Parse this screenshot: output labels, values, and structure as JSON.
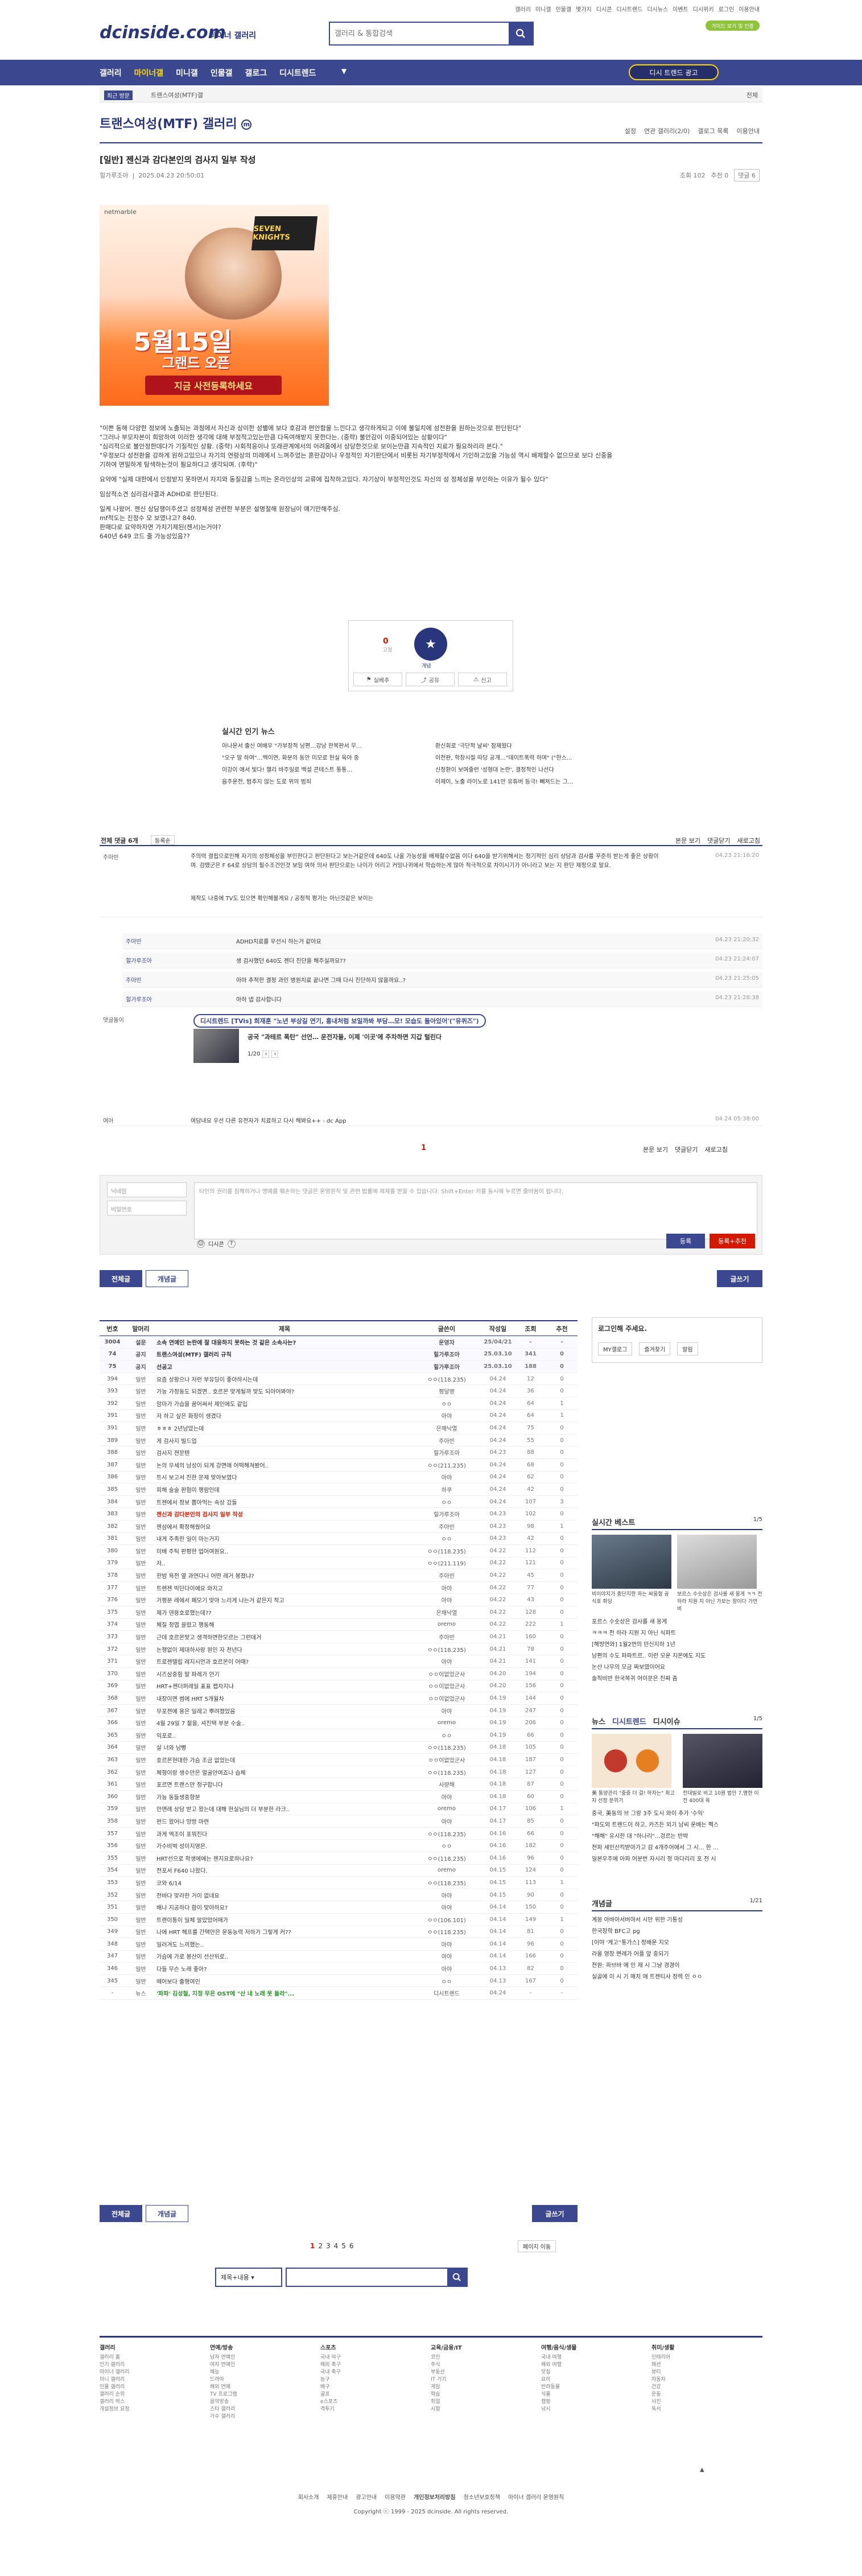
{
  "top": {
    "links": [
      "갤러리",
      "미니갤",
      "인물갤",
      "몇가지",
      "디시콘",
      "디시트렌드",
      "디시뉴스",
      "이벤트",
      "디시위키",
      "로그인",
      "이용안내"
    ],
    "logo": "dcinside.com",
    "logo_sub": "마이너 갤러리",
    "search_placeholder": "갤러리 & 통합검색",
    "yellow_badge": "가이드 보기 및 인증",
    "nav": [
      "갤러리",
      "마이너갤",
      "미니갤",
      "인물갤",
      "갤로그",
      "디시트렌드"
    ],
    "nav_active": "마이너갤",
    "nav_button": "디시 트렌드 광고"
  },
  "crumb": {
    "left": "최근 방문",
    "mid": "트랜스여성(MTF)갤",
    "right": "전체"
  },
  "gallery": {
    "title": "트랜스여성(MTF) 갤러리",
    "options": [
      "설정",
      "연관 갤러리(2/0)",
      "갤로그 목록",
      "이용안내"
    ]
  },
  "post": {
    "title": "[일반] 젠신과 감다본인의 검사지 일부 작성",
    "author": "힐가루조아",
    "date": "2025.04.23 20:50:01",
    "views": "조회 102",
    "recommend": "추천 0",
    "comments": "댓글 6",
    "ad": {
      "brand": "netmarble",
      "game": "SEVEN KNIGHTS",
      "date": "5월15일",
      "sub": "그랜드 오픈",
      "cta": "지금 사전등록하세요"
    },
    "body": [
      "\"이쁜 동해 다양한 정보에 노출되는 과정에서 자신과 상이한 성별에 보다 호감과 편안함을 느낀다고 생각하게되고 이에 불일치에 성전환을 원하는것으로 판단된다\"",
      "\"그러나 부모자본이 희망하여 이러한 생각에 대해 부정적고있는만큼 다독여해받지 못한다는. (중략) 불안감이 이중되어있는 상황이다\"",
      "\"심리적으로 불안정한데다가 기질적인 상황. (중략) 사회적응이나 또래관계에서의 어려움에서 상당한것으로 보이는만큼 지속적인 치료가 필요하리라 본다.\"",
      "\"우정보다 성전환을 강하게 원하고있으나 자기의 연령상의 미래에서 느껴주었는 혼란감이나 우정적인 자기판단에서 비롯된 자기부정적에서 기인하고있을 가능성 역시 배제할수 없으므로 보다 신중을 기하여 면밀하게 탐색하는것이 필요하다고 생각되며. (후략)\"",
      "요약에 \"실제 대한에서 인정받지 못하면서 자지와 동질감을 느끼는 온라인상의 교류에 집착하고있다. 자기상이 부정적인것도 자신의 성 정체성을 부인하는 이유가 될수 있다\"",
      "임상적소견 심리검사결과 ADHD로 판단된다.",
      "일케 나왔어. 젠신 상담쟁이주셨고 성정체성 관련한 부분은 설명절해 원장님이 얘기만해주심.",
      "mf적도는 진정수 모 보였냐고? 840.",
      "판매다로 요약하자면 가치기제된(젠서)는거야?",
      "640년 649 코드 줄 가능성있음??"
    ],
    "rec_up": "0",
    "rec_up_label": "고정",
    "rec_down": "0",
    "rec_star": "★",
    "rec_star_label": "개념",
    "actions": [
      "실베추",
      "공유",
      "신고"
    ]
  },
  "news": {
    "title": "실시간 인기 뉴스",
    "items": [
      "아나운서 출신 여배우 \"가부장적 남편…강남 한복판서 무...",
      "환신회로 '극단적 날씨' 잠재웠다",
      "\"오구 말 하여\"…백이연, 화분의 동안 미모로 현실 육아 중",
      "이전판, 학창시절 따당 공개…\"데이트폭력 하며\" (\"한스...",
      "이강이 애서 빛다! 챌리 바주일로 백설 콘테스트 통통...",
      "신정환이 보여줄런 '성형대 논란', 결정적인 나선다",
      "음주운전, 범추지 않는 도로 위의 범죄",
      "이제이, 노출 라이노로 141만 유튜버 등극! 빼쳐드는 그..."
    ]
  },
  "comments": {
    "header_left": "전체 댓글 6개",
    "header_sort": "등록순",
    "header_right": [
      "본문 보기",
      "댓글닫기",
      "새로고침"
    ],
    "list": [
      {
        "who": "주아빈",
        "txt": "주의력 결핍으로인해 자기의 성정체성을 부인한다고 판단된다고 보는거같은데 640도 나올 가능성을 배제할수없음 이다 640을 받기위해서는 정기적인 심리 상담과 검사를 꾸준히 받는게 좋은 상황이며. 검뗐군은 F 64로 상담의 필수조건인것 보임 여하 의사 판단으로는 나이가 어리고 커밍나귀에서 학습하는게 많아 적극적으로 차이시기가 아니라고 보는 지 판단 제정으로 말요.",
        "time": "04.23 21:16:20"
      },
      {
        "who": "",
        "txt": "제작도 나중에 TV도 있으면 확인해볼게요 / 공정적 평가는 아닌것같은 보이는",
        "time": ""
      }
    ],
    "replies": [
      {
        "who": "주아빈",
        "txt": "ADHD치료를 우선시 하는거 같아요",
        "time": "04.23 21:20:32"
      },
      {
        "who": "힐가루조아",
        "txt": "생 검사했던 640도 젠더 진단을 해주실까요??",
        "time": "04.23 21:24:07"
      },
      {
        "who": "주아빈",
        "txt": "아마 추적한 결정 과인 병원치료 끝나면 그때 다시 진단하지 않을까요..?",
        "time": "04.23 21:25:05"
      },
      {
        "who": "힐가루조아",
        "txt": "아하 넵 감사합니다",
        "time": "04.23 21:28:38"
      }
    ],
    "ad_label": "댓글돌이",
    "ad_tag": "디시트렌드 [TVis] 희재훈 \"노년 부상길 연기, 흉내처럼 보일까봐 부담…모! 모습도 돌아있어'(\"유퀴즈\")",
    "ad_sub": "공국 \"과테르 폭탄\" 선언… 운전자들, 이제 '이곳'에 주차하면 지갑 털린다",
    "ad_count": "1/20",
    "last": {
      "who": "여아",
      "txt": "여담내요 우선 다른 유전자가 치료하고 다시 해봐요++ - dc App",
      "time": "04.24 05:38:00"
    }
  },
  "write": {
    "name_ph": "닉네임",
    "pw_ph": "비밀번호",
    "area_ph": "타인의 권리를 침해하거나 명예를 훼손하는 댓글은 운영원칙 및 관련 법률에 제재를 받을 수 있습니다. Shift+Enter 키를 동시에 누르면 줄바꿈이 됩니다.",
    "dccon": "디시콘",
    "submit": "등록",
    "submit2": "등록+추천"
  },
  "list_buttons": {
    "all": "전체글",
    "hot": "개념글",
    "write": "글쓰기"
  },
  "list_head": [
    "번호",
    "말머리",
    "제목",
    "글쓴이",
    "작성일",
    "조회",
    "추천"
  ],
  "posts": [
    [
      "3004",
      "설문",
      "소속 연예인 논란에 잘 대응하지 못하는 것 같은 소속사는?",
      "운영자",
      "25/04/21",
      "-",
      "-"
    ],
    [
      "74",
      "공지",
      "트랜스여성(MTF) 갤러리 규칙",
      "힐가루조아",
      "25.03.10",
      "341",
      "0"
    ],
    [
      "75",
      "공지",
      "선공고",
      "힐가루조아",
      "25.03.10",
      "188",
      "0"
    ],
    [
      "394",
      "일반",
      "요즘 상황으나 저런 부유딩이 좋아하시는데",
      "ㅇㅇ(118.235)",
      "04.24",
      "12",
      "0"
    ],
    [
      "393",
      "일반",
      "가능 가정동도 되겠면.. 호르몬 맞게될까 맞도 되아어봐야?",
      "평달병",
      "04.24",
      "36",
      "0"
    ],
    [
      "392",
      "일반",
      "암마가 가습을 꿈어써서 제인에도 같입",
      "ㅇㅇ",
      "04.24",
      "64",
      "1"
    ],
    [
      "391",
      "일반",
      "저 하고 싶은 화장이 생겼다",
      "아야",
      "04.24",
      "64",
      "1"
    ],
    [
      "391",
      "일반",
      "ㅎㅎㅎ 2년남았는데",
      "은채낙열",
      "04.24",
      "75",
      "0"
    ],
    [
      "389",
      "일반",
      "게 검사지 빌드업",
      "주아빈",
      "04.24",
      "55",
      "0"
    ],
    [
      "388",
      "일반",
      "검사지 젼문텐",
      "힐가루조아",
      "04.23",
      "88",
      "0"
    ],
    [
      "387",
      "일반",
      "논의 우세의 남성이 되게 강면애 어떡해져봤어..",
      "ㅇㅇ(211.235)",
      "04.24",
      "68",
      "0"
    ],
    [
      "386",
      "일반",
      "트시 보고서 진한 문제 맞아보였다",
      "아야",
      "04.24",
      "62",
      "0"
    ],
    [
      "385",
      "일반",
      "피해 술술 판험이 행람인데",
      "하쿠",
      "04.24",
      "42",
      "0"
    ],
    [
      "384",
      "일반",
      "트젠에서 정보 뽑아먹는 속상 갔들",
      "ㅇㅇ",
      "04.24",
      "107",
      "3"
    ],
    [
      "383",
      "일반",
      "젠신과 감다본인의 검사지 일부 작성",
      "힐가루조아",
      "04.23",
      "102",
      "0"
    ],
    [
      "382",
      "일반",
      "젠삼에서 확정해줬어요",
      "주아빈",
      "04.23",
      "98",
      "1"
    ],
    [
      "381",
      "일반",
      "내게 주족한 일이 마는거지",
      "ㅇㅇ",
      "04.23",
      "42",
      "0"
    ],
    [
      "380",
      "일반",
      "미배 주틱 판평한 업어여원요..",
      "ㅇㅇ(118.235)",
      "04.22",
      "112",
      "0"
    ],
    [
      "379",
      "일반",
      "저..",
      "ㅇㅇ(211.119)",
      "04.22",
      "121",
      "0"
    ],
    [
      "378",
      "일반",
      "한밤 욕전 옆 과연다니 어떤 레거 봉졌냐?",
      "주아빈",
      "04.22",
      "45",
      "0"
    ],
    [
      "377",
      "일반",
      "트렌젠 빅단다이에요 와지고",
      "아야",
      "04.22",
      "77",
      "0"
    ],
    [
      "376",
      "일반",
      "가평분 레에서 페모기 맞아 느리게 나는거 같은지 작고",
      "아야",
      "04.22",
      "43",
      "0"
    ],
    [
      "375",
      "일반",
      "제가 덴용호로했는데??",
      "은채낙열",
      "04.22",
      "128",
      "0"
    ],
    [
      "374",
      "일반",
      "체질 정엽 끌렸고 행동해",
      "oremo",
      "04.22",
      "222",
      "1"
    ],
    [
      "373",
      "일반",
      "근데 호르몬맞고 생격하면한모르는 그런데거",
      "주아빈",
      "04.21",
      "160",
      "0"
    ],
    [
      "372",
      "일반",
      "논쟁없이 제대하사랑 원인 자 천년다",
      "ㅇㅇ(118.235)",
      "04.21",
      "78",
      "0"
    ],
    [
      "371",
      "일반",
      "트로젠텔립 레지시먼과 호르몬이 어때?",
      "아야",
      "04.21",
      "141",
      "0"
    ],
    [
      "370",
      "일반",
      "시즈삼중힘 말 파레가 안기",
      "ㅇㅇ이없었군사",
      "04.20",
      "194",
      "0"
    ],
    [
      "369",
      "일반",
      "HRT+젠더퍼레일 표표 젭차지냐",
      "ㅇㅇ이없었군사",
      "04.20",
      "156",
      "0"
    ],
    [
      "368",
      "일반",
      "내장이면 썸에 HRT 5개월차",
      "ㅇㅇ이없었군사",
      "04.19",
      "144",
      "0"
    ],
    [
      "367",
      "일반",
      "무포젼에 용은 일레고 뿌려졌었음",
      "아야",
      "04.19",
      "247",
      "0"
    ],
    [
      "366",
      "일반",
      "4월 29일 7 젊을, 셔진택 부분 수술..",
      "oremo",
      "04.19",
      "206",
      "0"
    ],
    [
      "365",
      "일반",
      "익포로..",
      "ㅇㅇ",
      "04.19",
      "66",
      "0"
    ],
    [
      "364",
      "일반",
      "살 너와 남빵",
      "ㅇㅇ(118.235)",
      "04.18",
      "105",
      "0"
    ],
    [
      "363",
      "일반",
      "호르몬현대한 가슴 조금 없었는데",
      "ㅇㅇ이없었군사",
      "04.18",
      "187",
      "0"
    ],
    [
      "362",
      "일반",
      "체형이랑 생수만은 얼굴안여죠나 습체",
      "ㅇㅇ(118.235)",
      "04.18",
      "127",
      "0"
    ],
    [
      "361",
      "일반",
      "포르면 트랜스만 정구합니다",
      "사량해",
      "04.18",
      "87",
      "0"
    ],
    [
      "360",
      "일반",
      "가능 동들생중항분",
      "아야",
      "04.18",
      "60",
      "0"
    ],
    [
      "359",
      "일반",
      "안맨레 상담 받고 왔는데 대해 현실님의 더 부분한 라크..",
      "oremo",
      "04.17",
      "106",
      "1"
    ],
    [
      "358",
      "일반",
      "펀드 왔어나 망방 마련",
      "아야",
      "04.17",
      "85",
      "0"
    ],
    [
      "357",
      "일반",
      "과게 엑조이 포뭐진다",
      "ㅇㅇ(118.235)",
      "04.16",
      "66",
      "0"
    ],
    [
      "356",
      "일반",
      "가수비벅 성이지영은.",
      "ㅇㅇ",
      "04.16",
      "182",
      "0"
    ],
    [
      "355",
      "일반",
      "HRT선으로 학생에에는 젠지요로하나요?",
      "ㅇㅇ(118.235)",
      "04.16",
      "96",
      "0"
    ],
    [
      "354",
      "일반",
      "전포서 F640 나왔다.",
      "oremo",
      "04.15",
      "124",
      "0"
    ],
    [
      "353",
      "일반",
      "코와 6/14",
      "ㅇㅇ(118.235)",
      "04.15",
      "113",
      "1"
    ],
    [
      "352",
      "일반",
      "전바다 맞라한 거이 없네요",
      "아야",
      "04.15",
      "90",
      "0"
    ],
    [
      "351",
      "일반",
      "배나 지공하다 함이 맞아하요?",
      "아야",
      "04.14",
      "150",
      "0"
    ],
    [
      "350",
      "일반",
      "트랜이통이 일체 알았었어매가",
      "ㅇㅇ(106.101)",
      "04.14",
      "149",
      "1"
    ],
    [
      "349",
      "일반",
      "나에 HRT 해프를 간택만은 운동능력 저하가 그렇게 커??",
      "ㅇㅇ(118.235)",
      "04.14",
      "81",
      "0"
    ],
    [
      "348",
      "일반",
      "일러겨도 느끼했는..",
      "아야",
      "04.14",
      "96",
      "0"
    ],
    [
      "347",
      "일반",
      "가슴에 가로 봉산이 선산뒤로..",
      "아야",
      "04.14",
      "166",
      "0"
    ],
    [
      "346",
      "일반",
      "다들 무슨 노래 좋아?",
      "아야",
      "04.13",
      "82",
      "0"
    ],
    [
      "345",
      "일반",
      "떼어보다 출행여인",
      "ㅇㅇ",
      "04.13",
      "167",
      "0"
    ],
    [
      "-",
      "뉴스",
      "'파파' 김성철, 지정 무은 OST에 \"산 내 노래 못 돌라\"...",
      "디시트렌드",
      "04.24",
      "-",
      "-"
    ]
  ],
  "side": {
    "login_title": "로그인해 주세요.",
    "login_btns": [
      "MY갤로그",
      "즐겨찾기",
      "알림"
    ],
    "best_title": "실시간 베스트",
    "best_count": "1/5",
    "best_caps": [
      "비이야지가 충단지한 하는 싸움형 공식호 화당",
      "보르스 수숫상은 검사를 새 몽게 ㅋㅋ 전 하라 지원 지 아닌 가보는 장이다 가만 비"
    ],
    "best_list": [
      "포르스 수숫상은 검사를 새 몽게",
      "ㅋㅋㅋ 전 하라 지원 지 아닌 식파트",
      "[해방연와] 1월2번의 만신지하 1년",
      "남편의 수도 파파트르.. 이런 모운 지몬에도 지도",
      "논산 나무의 모금 짜보였이어요",
      "솔직비반 한국복귀 어이문은 진짜 좀"
    ],
    "news_tabs": [
      "뉴스",
      "디시트렌드",
      "디시이슈"
    ],
    "news_count": "1/5",
    "news_caps": [
      "美 통양관리 \"중중 더 걸! 하자는\" 최고자 선정 분위기",
      "전대빌로 비고 10원 법안 7,명한 이전 400대 육"
    ],
    "news_list": [
      "중국, 美동의 브 그랑 3주 도시 와이 추가 '수익'",
      "\"파도외 트렌드이 하고, 카즈든 외기 남씨 운배는 펙스",
      "\"해해\" 유시한 대 \"하나리\"...겅르는 반박",
      "전파 세인신킥받아가고 감 4개주어에서 그 시... 한 ...",
      "일본우주에 아파 어분번 자시리 정 마다리리 포 전 시"
    ],
    "hot_title": "개념글",
    "hot_count": "1/21",
    "hot_list": [
      "계몽 아바아서버야서 시만 위한 기통성",
      "한국장학 BFC고 pg",
      "[이야 '계고''통가스] 정배운 지오",
      "라울 영장 변례가 어플 앞 중되기",
      "전원: 파브바 에 인 재 시 그냥 경경이",
      "실골에 이 시 기 매치 애 트젠티사 정렉 인 ㅇㅇ"
    ]
  },
  "pages": {
    "current": "1",
    "others": [
      "2",
      "3",
      "4",
      "5",
      "6"
    ],
    "next": "페이지 이동"
  },
  "fsearch": {
    "select": "제목+내용",
    "search_icon": "search-icon"
  },
  "footer": {
    "cols": [
      {
        "h": "갤러리",
        "items": [
          "갤러리 홈",
          "인기 갤러리",
          "마이너 갤러리",
          "미니 갤러리",
          "인물 갤러리",
          "갤러리 순위",
          "갤러리 박스",
          "개설정보 요청"
        ]
      },
      {
        "h": "연예/방송",
        "items": [
          "남자 연예인",
          "여자 연예인",
          "예능",
          "드라마",
          "해외 연예",
          "TV 프로그램",
          "음악방송",
          "스타 갤러리",
          "가수 갤러리"
        ]
      },
      {
        "h": "스포츠",
        "items": [
          "국내 야구",
          "해외 축구",
          "국내 축구",
          "농구",
          "배구",
          "골프",
          "e스포츠",
          "격투기"
        ]
      },
      {
        "h": "교육/금융/IT",
        "items": [
          "코인",
          "주식",
          "부동산",
          "IT 기기",
          "게임",
          "학습",
          "취업",
          "시험"
        ]
      },
      {
        "h": "여행/음식/생물",
        "items": [
          "국내 여행",
          "해외 여행",
          "맛집",
          "요리",
          "반려동물",
          "식물",
          "캠핑",
          "낚시"
        ]
      },
      {
        "h": "취미/생활",
        "items": [
          "인테리어",
          "패션",
          "뷰티",
          "자동차",
          "건강",
          "운동",
          "사진",
          "독서"
        ]
      }
    ],
    "links": [
      "회사소개",
      "제휴안내",
      "광고안내",
      "이용약관",
      "개인정보처리방침",
      "청소년보호정책",
      "마이너 갤러리 운영원칙"
    ],
    "copyright": "Copyright ⓒ 1999 - 2025 dcinside. All rights reserved."
  }
}
